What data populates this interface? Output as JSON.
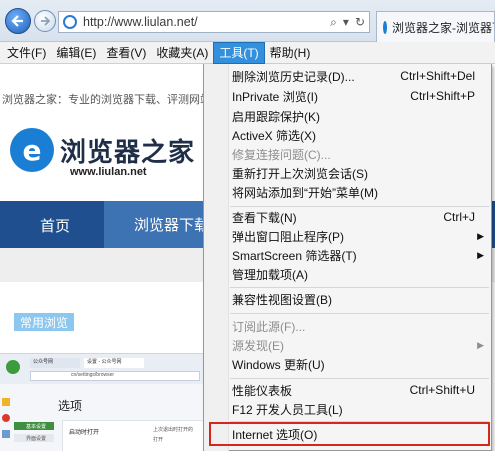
{
  "browser": {
    "address_url": "http://www.liulan.net/",
    "tab_title": "浏览器之家-浏览器下",
    "address_icons": [
      "search-icon",
      "refresh-icon"
    ]
  },
  "menubar": {
    "items": [
      "文件(F)",
      "编辑(E)",
      "查看(V)",
      "收藏夹(A)",
      "工具(T)",
      "帮助(H)"
    ],
    "active_index": 4
  },
  "page": {
    "tagline": "浏览器之家：专业的浏览器下载、评测网站",
    "logo_letter": "e",
    "logo_name": "浏览器之家",
    "logo_domain": "www.liulan.net",
    "nav_home": "首页",
    "nav_download": "浏览器下载",
    "common_tag": "常用浏览",
    "thumb_options_title": "选项",
    "thumb_tab1": "公众号网",
    "thumb_tab2": "设置 - 公众号网",
    "thumb_addr": "cn/settings/browser",
    "thumb_panel_label": "启动时打开",
    "thumb_panel_opt1": "上次退出时打开的",
    "thumb_panel_opt2": "打开",
    "thumb_side_label": "基本设置",
    "thumb_side_label2": "界面设置"
  },
  "tools_menu": {
    "items": [
      {
        "label": "删除浏览历史记录(D)...",
        "shortcut": "Ctrl+Shift+Del",
        "disabled": false
      },
      {
        "label": "InPrivate 浏览(I)",
        "shortcut": "Ctrl+Shift+P",
        "disabled": false
      },
      {
        "label": "启用跟踪保护(K)",
        "shortcut": "",
        "disabled": false
      },
      {
        "label": "ActiveX 筛选(X)",
        "shortcut": "",
        "disabled": false
      },
      {
        "label": "修复连接问题(C)...",
        "shortcut": "",
        "disabled": true
      },
      {
        "label": "重新打开上次浏览会话(S)",
        "shortcut": "",
        "disabled": false
      },
      {
        "label": "将网站添加到“开始”菜单(M)",
        "shortcut": "",
        "disabled": false
      },
      {
        "label": "查看下载(N)",
        "shortcut": "Ctrl+J",
        "disabled": false
      },
      {
        "label": "弹出窗口阻止程序(P)",
        "shortcut": "",
        "submenu": true,
        "disabled": false
      },
      {
        "label": "SmartScreen 筛选器(T)",
        "shortcut": "",
        "submenu": true,
        "disabled": false
      },
      {
        "label": "管理加载项(A)",
        "shortcut": "",
        "disabled": false
      },
      {
        "label": "兼容性视图设置(B)",
        "shortcut": "",
        "disabled": false
      },
      {
        "label": "订阅此源(F)...",
        "shortcut": "",
        "disabled": true
      },
      {
        "label": "源发现(E)",
        "shortcut": "",
        "submenu": true,
        "disabled": true
      },
      {
        "label": "Windows 更新(U)",
        "shortcut": "",
        "disabled": false
      },
      {
        "label": "性能仪表板",
        "shortcut": "Ctrl+Shift+U",
        "disabled": false
      },
      {
        "label": "F12 开发人员工具(L)",
        "shortcut": "",
        "disabled": false
      },
      {
        "label": "Internet 选项(O)",
        "shortcut": "",
        "disabled": false,
        "highlighted": true
      }
    ]
  },
  "colors": {
    "menu_active": "#3390dd",
    "nav_band": "#1f4f8f",
    "highlight_border": "#d6271f",
    "logo_blue": "#1a7fd4"
  }
}
